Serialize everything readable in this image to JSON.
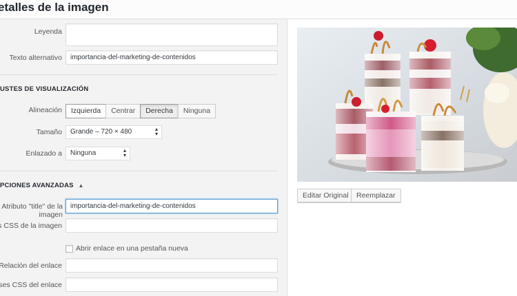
{
  "header": {
    "title": "etalles de la imagen"
  },
  "form": {
    "caption": {
      "label": "Leyenda",
      "value": ""
    },
    "alt_text": {
      "label": "Texto alternativo",
      "value": "importancia-del-marketing-de-contenidos"
    }
  },
  "display_settings": {
    "title": "USTES DE VISUALIZACIÓN",
    "alignment": {
      "label": "Alineación",
      "options": [
        "Izquierda",
        "Centrar",
        "Derecha",
        "Ninguna"
      ],
      "selected": "Derecha"
    },
    "size": {
      "label": "Tamaño",
      "value": "Grande – 720 × 480"
    },
    "link_to": {
      "label": "Enlazado a",
      "value": "Ninguna"
    }
  },
  "advanced": {
    "title": "PCIONES AVANZADAS",
    "toggle_glyph": "▲",
    "title_attr": {
      "label_line1": "Atributo \"title\" de la",
      "label_line2": "imagen",
      "value": "importancia-del-marketing-de-contenidos"
    },
    "image_css": {
      "label": "ses CSS de la imagen",
      "value": ""
    },
    "new_tab": {
      "label": "Abrir enlace en una pestaña nueva",
      "checked": false
    },
    "link_rel": {
      "label": "Relación del enlace",
      "value": ""
    },
    "link_css": {
      "label": "Clases CSS del enlace",
      "value": ""
    }
  },
  "image_actions": {
    "edit_original": "Editar Original",
    "replace": "Reemplazar"
  },
  "colors": {
    "focus_border": "#5b9dd9",
    "panel_bg": "#f3f3f3"
  }
}
